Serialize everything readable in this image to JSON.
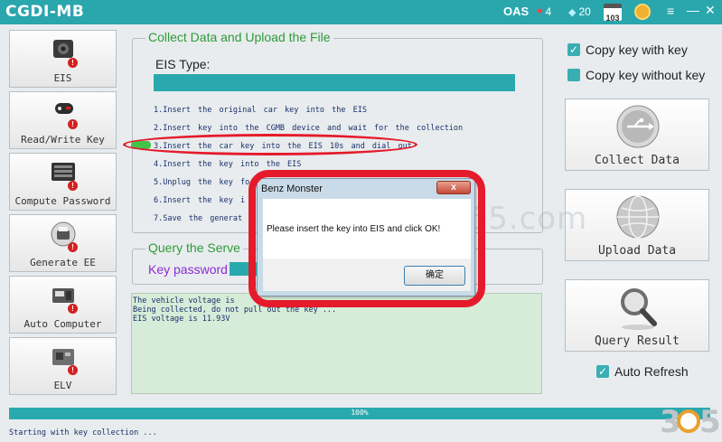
{
  "window": {
    "title": "CGDI-MB",
    "oas": "OAS",
    "hearts": "4",
    "gems": "20",
    "calendar_day": "103",
    "menu_glyph": "≡",
    "minimize_glyph": "—",
    "close_glyph": "✕"
  },
  "sidebar": {
    "items": [
      {
        "label": "EIS",
        "icon": "eis-module-icon"
      },
      {
        "label": "Read/Write Key",
        "icon": "car-key-icon"
      },
      {
        "label": "Compute Password",
        "icon": "keyboard-icon"
      },
      {
        "label": "Generate EE",
        "icon": "printer-icon"
      },
      {
        "label": "Auto Computer",
        "icon": "ecu-icon"
      },
      {
        "label": "ELV",
        "icon": "elv-module-icon"
      }
    ],
    "badge": "!"
  },
  "collect_group": {
    "title": "Collect Data and Upload the File",
    "eis_type_label": "EIS Type:",
    "steps": [
      "1.Insert the original car key into the EIS",
      "2.Insert key into the CGMB device and wait for the collection",
      "3.Insert the car key into the EIS 10s and dial out",
      "4.Insert the key into the EIS",
      "5.Unplug the key fo",
      "6.Insert the key i",
      "7.Save the generat"
    ]
  },
  "query_group": {
    "title": "Query the Serve",
    "key_password_label": "Key password"
  },
  "log": {
    "lines": [
      "The vehicle voltage is",
      "Being collected, do not pull out the key ...",
      "EIS voltage is 11.93V"
    ]
  },
  "right_panel": {
    "copy_with_key": {
      "label": "Copy key with key",
      "checked": true
    },
    "copy_without_key": {
      "label": "Copy key without key",
      "checked": false
    },
    "collect_button": "Collect Data",
    "upload_button": "Upload  Data",
    "query_button": "Query Result",
    "auto_refresh": {
      "label": "Auto Refresh",
      "checked": true
    }
  },
  "progress": {
    "value": 100,
    "label": "100%"
  },
  "status_text": "Starting with key collection ...",
  "watermark": "www.obdii365.com",
  "logo_text": "365",
  "dialog": {
    "title": "Benz Monster",
    "close_glyph": "x",
    "message": "Please insert the key into EIS and click OK!",
    "ok_label": "确定"
  },
  "colors": {
    "accent": "#29a9ae",
    "highlight": "#e51a2b",
    "group_title": "#2f9a3a",
    "key_password": "#8e2bd6",
    "log_bg": "#d6ecd8"
  }
}
